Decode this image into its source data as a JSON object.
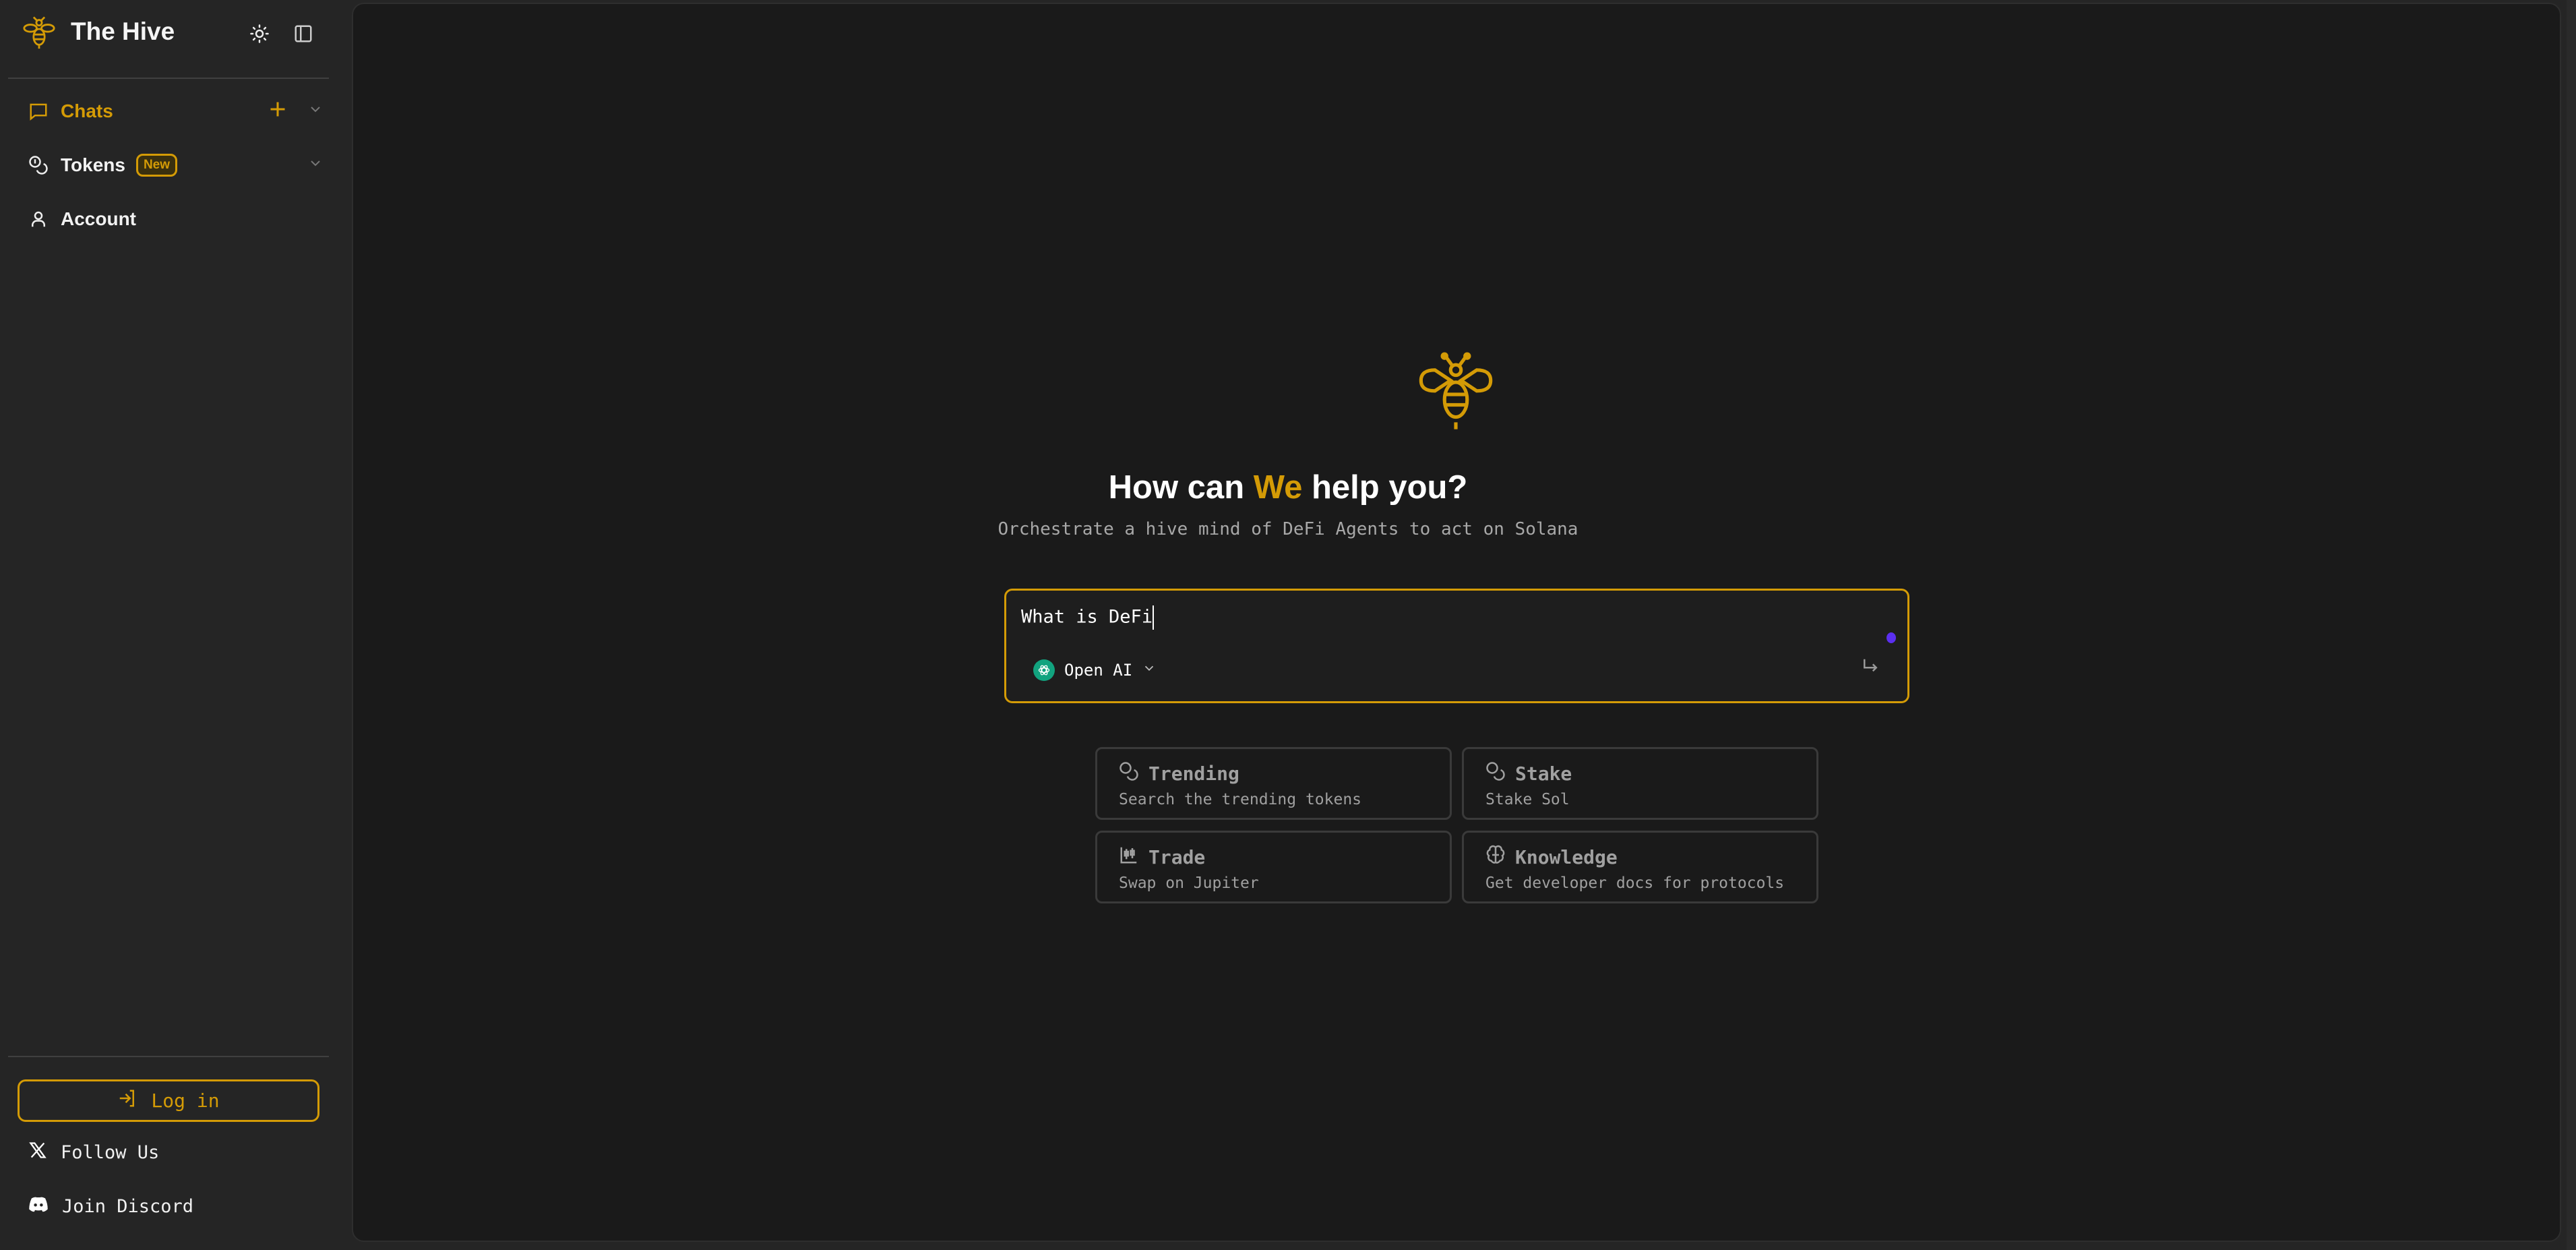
{
  "brand": {
    "title": "The Hive",
    "accent": "#d49b06"
  },
  "sidebar": {
    "items": [
      {
        "label": "Chats",
        "icon": "message-square-icon",
        "active": true
      },
      {
        "label": "Tokens",
        "icon": "coins-icon",
        "badge": "New"
      },
      {
        "label": "Account",
        "icon": "user-icon"
      }
    ],
    "login_label": "Log in",
    "follow_label": "Follow Us",
    "discord_label": "Join Discord"
  },
  "main": {
    "heading_pre": "How can ",
    "heading_accent": "We",
    "heading_post": " help you?",
    "subtitle": "Orchestrate a hive mind of DeFi Agents to act on Solana",
    "input": {
      "value": "What is DeFi",
      "model": "Open AI"
    },
    "cards": [
      {
        "title": "Trending",
        "desc": "Search the trending tokens",
        "icon": "coins-icon"
      },
      {
        "title": "Stake",
        "desc": "Stake Sol",
        "icon": "coins-icon"
      },
      {
        "title": "Trade",
        "desc": "Swap on Jupiter",
        "icon": "candlestick-chart-icon"
      },
      {
        "title": "Knowledge",
        "desc": "Get developer docs for protocols",
        "icon": "brain-icon"
      }
    ]
  }
}
